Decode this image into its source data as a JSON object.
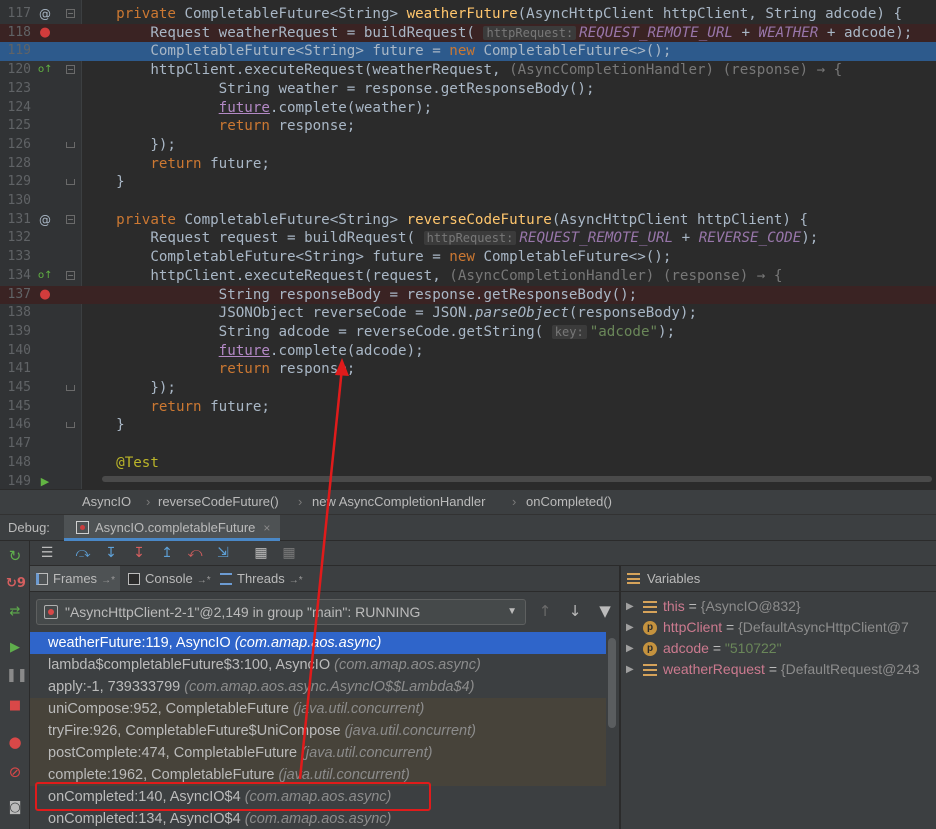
{
  "editor": {
    "lines": [
      {
        "num": "117",
        "gutter": "at",
        "fold": "open",
        "segs": [
          [
            "k",
            "    private "
          ],
          [
            "t",
            "CompletableFuture<String> "
          ],
          [
            "m",
            "weatherFuture"
          ],
          [
            "t",
            "(AsyncHttpClient httpClient, String adcode) {"
          ]
        ]
      },
      {
        "num": "118",
        "gutter": "bp",
        "style": "bp",
        "segs": [
          [
            "t",
            "        Request weatherRequest = buildRequest( "
          ],
          [
            "hint",
            "httpRequest:"
          ],
          [
            "c",
            "REQUEST_REMOTE_URL"
          ],
          [
            "t",
            " + "
          ],
          [
            "c",
            "WEATHER"
          ],
          [
            "t",
            " + adcode);"
          ]
        ]
      },
      {
        "num": "119",
        "style": "sel",
        "segs": [
          [
            "t",
            "        CompletableFuture<String> future = "
          ],
          [
            "k",
            "new "
          ],
          [
            "t",
            "CompletableFuture<>();"
          ]
        ]
      },
      {
        "num": "120",
        "gutter": "ov",
        "fold": "open",
        "segs": [
          [
            "t",
            "        httpClient.executeRequest(weatherRequest, "
          ],
          [
            "lam",
            "(AsyncCompletionHandler) (response) → {"
          ]
        ]
      },
      {
        "num": "123",
        "segs": [
          [
            "t",
            "                String weather = response.getResponseBody();"
          ]
        ]
      },
      {
        "num": "124",
        "segs": [
          [
            "t",
            "                "
          ],
          [
            "ul",
            "future"
          ],
          [
            "t",
            ".complete(weather);"
          ]
        ]
      },
      {
        "num": "125",
        "segs": [
          [
            "k",
            "                return "
          ],
          [
            "t",
            "response;"
          ]
        ]
      },
      {
        "num": "126",
        "fold": "end",
        "segs": [
          [
            "t",
            "        });"
          ]
        ]
      },
      {
        "num": "128",
        "segs": [
          [
            "k",
            "        return "
          ],
          [
            "t",
            "future;"
          ]
        ]
      },
      {
        "num": "129",
        "fold": "end",
        "segs": [
          [
            "t",
            "    }"
          ]
        ]
      },
      {
        "num": "130",
        "segs": []
      },
      {
        "num": "131",
        "gutter": "at",
        "fold": "open",
        "segs": [
          [
            "k",
            "    private "
          ],
          [
            "t",
            "CompletableFuture<String> "
          ],
          [
            "m",
            "reverseCodeFuture"
          ],
          [
            "t",
            "(AsyncHttpClient httpClient) {"
          ]
        ]
      },
      {
        "num": "132",
        "segs": [
          [
            "t",
            "        Request request = buildRequest( "
          ],
          [
            "hint",
            "httpRequest:"
          ],
          [
            "c",
            "REQUEST_REMOTE_URL"
          ],
          [
            "t",
            " + "
          ],
          [
            "c",
            "REVERSE_CODE"
          ],
          [
            "t",
            ");"
          ]
        ]
      },
      {
        "num": "133",
        "segs": [
          [
            "t",
            "        CompletableFuture<String> future = "
          ],
          [
            "k",
            "new "
          ],
          [
            "t",
            "CompletableFuture<>();"
          ]
        ]
      },
      {
        "num": "134",
        "gutter": "ov",
        "fold": "open",
        "segs": [
          [
            "t",
            "        httpClient.executeRequest(request, "
          ],
          [
            "lam",
            "(AsyncCompletionHandler) (response) → {"
          ]
        ]
      },
      {
        "num": "137",
        "gutter": "bp",
        "style": "bp",
        "segs": [
          [
            "t",
            "                String responseBody = response.getResponseBody();"
          ]
        ]
      },
      {
        "num": "138",
        "segs": [
          [
            "t",
            "                JSONObject reverseCode = JSON."
          ],
          [
            "it",
            "parseObject"
          ],
          [
            "t",
            "(responseBody);"
          ]
        ]
      },
      {
        "num": "139",
        "segs": [
          [
            "t",
            "                String adcode = reverseCode.getString( "
          ],
          [
            "hint",
            "key:"
          ],
          [
            "s",
            "\"adcode\""
          ],
          [
            "t",
            ");"
          ]
        ]
      },
      {
        "num": "140",
        "segs": [
          [
            "t",
            "                "
          ],
          [
            "ul",
            "future"
          ],
          [
            "t",
            ".complete(adcode);"
          ]
        ]
      },
      {
        "num": "141",
        "segs": [
          [
            "k",
            "                return "
          ],
          [
            "t",
            "response;"
          ]
        ]
      },
      {
        "num": "145",
        "fold": "end",
        "segs": [
          [
            "t",
            "        });"
          ]
        ]
      },
      {
        "num": "145",
        "segs": [
          [
            "k",
            "        return "
          ],
          [
            "t",
            "future;"
          ]
        ]
      },
      {
        "num": "146",
        "fold": "end",
        "segs": [
          [
            "t",
            "    }"
          ]
        ]
      },
      {
        "num": "147",
        "segs": []
      },
      {
        "num": "148",
        "segs": [
          [
            "t",
            "    "
          ],
          [
            "an",
            "@Test"
          ]
        ]
      },
      {
        "num": "149",
        "gutter": "run",
        "segs": []
      }
    ]
  },
  "breadcrumb": [
    "AsyncIO",
    "reverseCodeFuture()",
    "new AsyncCompletionHandler",
    "onCompleted()"
  ],
  "debug": {
    "label": "Debug:",
    "tab": "AsyncIO.completableFuture",
    "close": "×"
  },
  "panels": {
    "frames_tab": "Frames",
    "console_tab": "Console",
    "threads_tab": "Threads",
    "pin": "→*",
    "variables_title": "Variables"
  },
  "thread": "\"AsyncHttpClient-2-1\"@2,149 in group \"main\": RUNNING",
  "frames": [
    {
      "method": "weatherFuture:119, AsyncIO",
      "pkg": "(com.amap.aos.async)",
      "kind": "selected"
    },
    {
      "method": "lambda$completableFuture$3:100, AsyncIO",
      "pkg": "(com.amap.aos.async)",
      "kind": "normal"
    },
    {
      "method": "apply:-1, 739333799",
      "pkg": "(com.amap.aos.async.AsyncIO$$Lambda$4)",
      "kind": "normal"
    },
    {
      "method": "uniCompose:952, CompletableFuture",
      "pkg": "(java.util.concurrent)",
      "kind": "lib"
    },
    {
      "method": "tryFire:926, CompletableFuture$UniCompose",
      "pkg": "(java.util.concurrent)",
      "kind": "lib"
    },
    {
      "method": "postComplete:474, CompletableFuture",
      "pkg": "(java.util.concurrent)",
      "kind": "lib"
    },
    {
      "method": "complete:1962, CompletableFuture",
      "pkg": "(java.util.concurrent)",
      "kind": "lib"
    },
    {
      "method": "onCompleted:140, AsyncIO$4",
      "pkg": "(com.amap.aos.async)",
      "kind": "normal"
    },
    {
      "method": "onCompleted:134, AsyncIO$4",
      "pkg": "(com.amap.aos.async)",
      "kind": "normal"
    }
  ],
  "variables": [
    {
      "name": "this",
      "eq": " = ",
      "value": "{AsyncIO@832}",
      "icon": "field",
      "vtype": "obj"
    },
    {
      "name": "httpClient",
      "eq": " = ",
      "value": "{DefaultAsyncHttpClient@7",
      "icon": "param",
      "vtype": "obj"
    },
    {
      "name": "adcode",
      "eq": " = ",
      "value": "\"510722\"",
      "icon": "param",
      "vtype": "str"
    },
    {
      "name": "weatherRequest",
      "eq": " = ",
      "value": "{DefaultRequest@243",
      "icon": "field",
      "vtype": "obj"
    }
  ],
  "colors": {
    "accent": "#2f65ca",
    "annotation": "#e01b1b",
    "breakpoint": "#d23c3c"
  }
}
